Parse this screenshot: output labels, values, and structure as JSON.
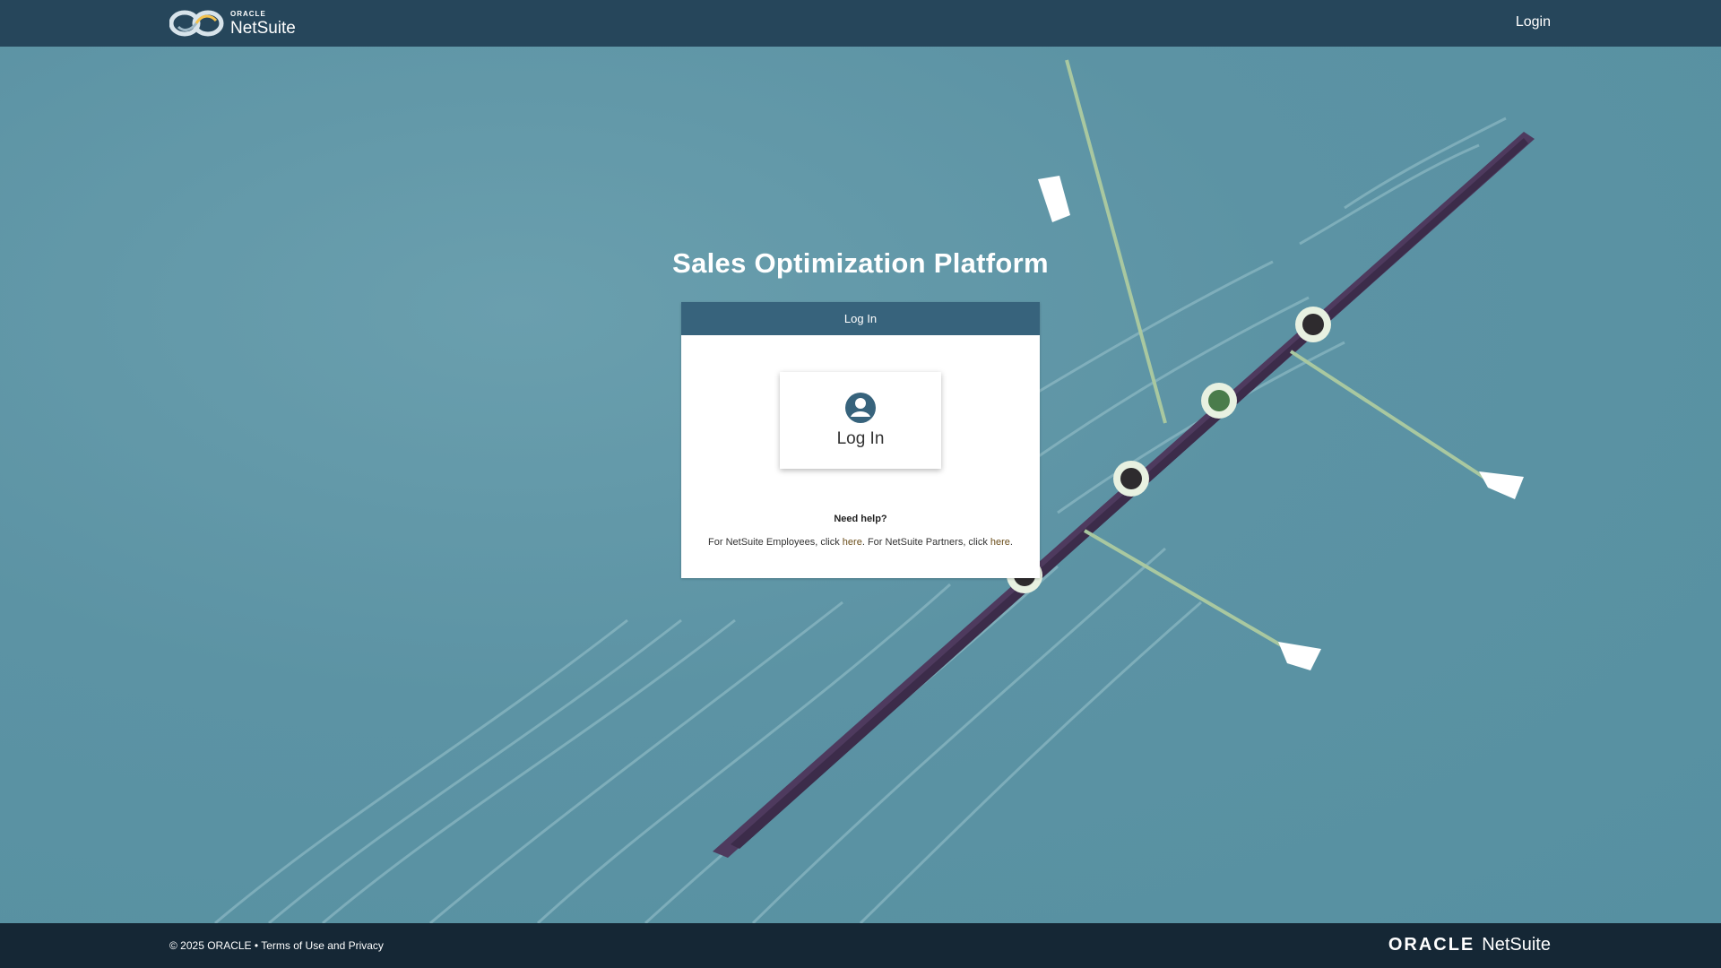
{
  "header": {
    "logo_small": "ORACLE",
    "logo_large": "NetSuite",
    "login_link": "Login"
  },
  "main": {
    "title": "Sales Optimization Platform",
    "card_header": "Log In",
    "tile_label": "Log In",
    "help_title": "Need help?",
    "help_text_1": "For NetSuite Employees, click ",
    "help_link_1": "here",
    "help_text_2": ". For NetSuite Partners, click ",
    "help_link_2": "here",
    "help_text_3": "."
  },
  "footer": {
    "copyright": "© 2025 ORACLE • ",
    "terms_link": "Terms of Use and Privacy",
    "logo_oracle": "ORACLE",
    "logo_netsuite": "NetSuite"
  },
  "colors": {
    "topbar": "#26465b",
    "water": "#5e95a5",
    "card_header": "#37637c",
    "footer": "#152735",
    "boat": "#4e3a5e"
  },
  "icons": [
    "netsuite-logo-icon",
    "user-circle-icon"
  ]
}
